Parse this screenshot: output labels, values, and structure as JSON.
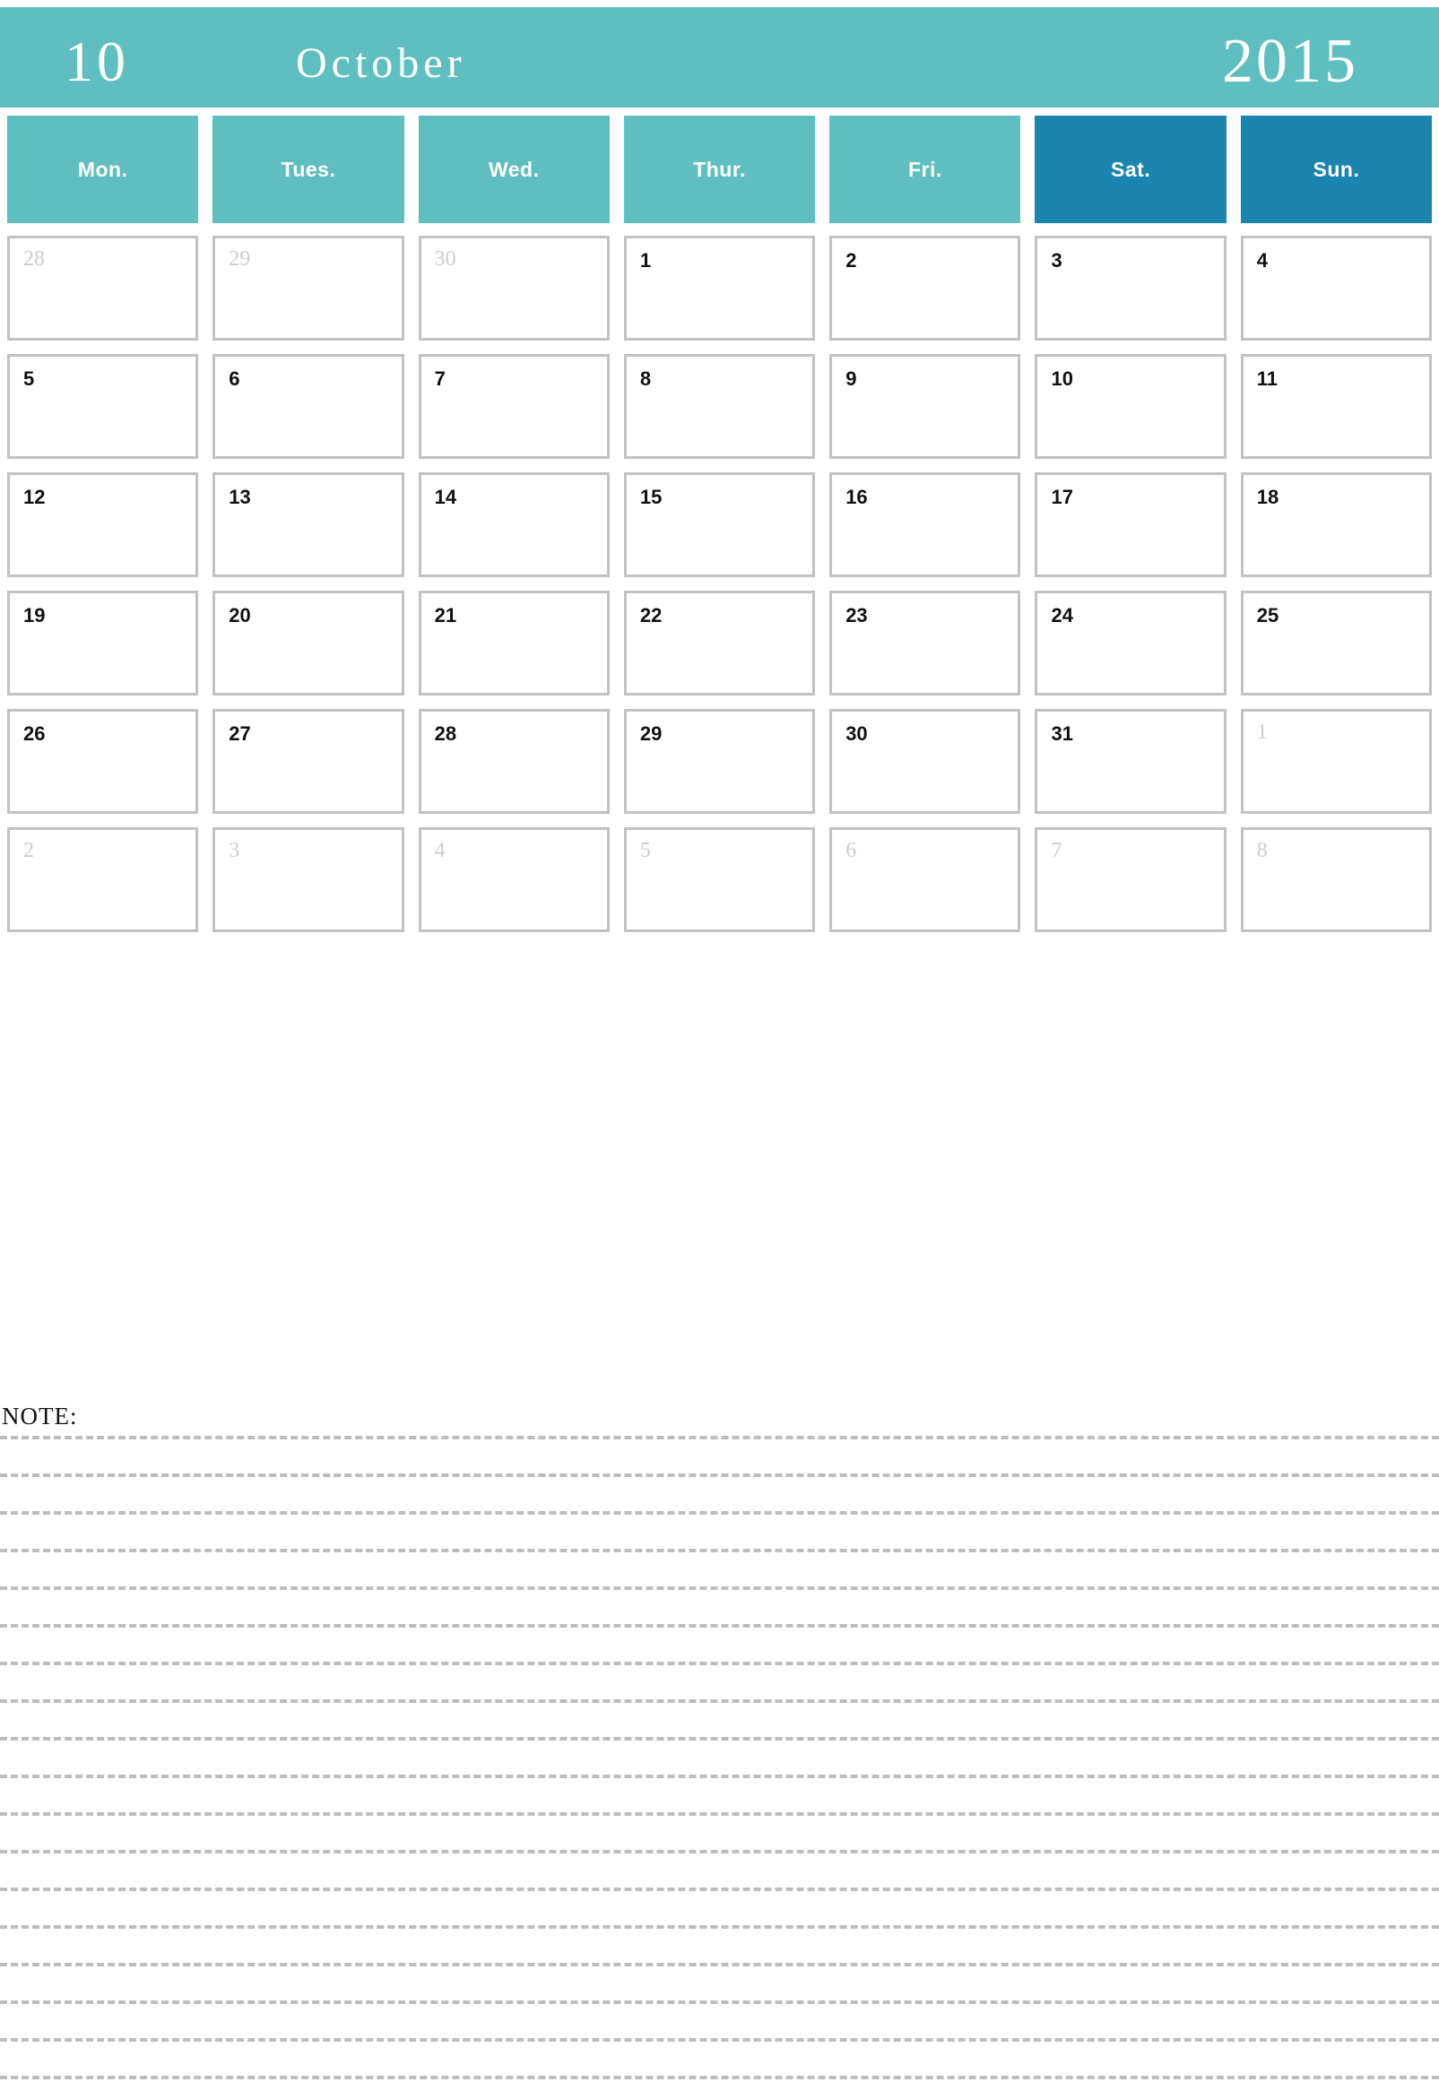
{
  "header": {
    "month_number": "10",
    "month_name": "October",
    "year": "2015",
    "background_color": "#5FBFC0",
    "text_color": "#ffffff"
  },
  "colors": {
    "weekday_header": "#5FBFC0",
    "weekend_header": "#1B85AE",
    "cell_border": "#c2c2c2",
    "active_day_text": "#111111",
    "muted_day_text": "#cccccc",
    "note_line": "#bdbdbd"
  },
  "weekday_headers": [
    {
      "label": "Mon.",
      "weekend": false
    },
    {
      "label": "Tues.",
      "weekend": false
    },
    {
      "label": "Wed.",
      "weekend": false
    },
    {
      "label": "Thur.",
      "weekend": false
    },
    {
      "label": "Fri.",
      "weekend": false
    },
    {
      "label": "Sat.",
      "weekend": true
    },
    {
      "label": "Sun.",
      "weekend": true
    }
  ],
  "weeks": [
    [
      {
        "day": "28",
        "muted": true
      },
      {
        "day": "29",
        "muted": true
      },
      {
        "day": "30",
        "muted": true
      },
      {
        "day": "1",
        "muted": false
      },
      {
        "day": "2",
        "muted": false
      },
      {
        "day": "3",
        "muted": false
      },
      {
        "day": "4",
        "muted": false
      }
    ],
    [
      {
        "day": "5",
        "muted": false
      },
      {
        "day": "6",
        "muted": false
      },
      {
        "day": "7",
        "muted": false
      },
      {
        "day": "8",
        "muted": false
      },
      {
        "day": "9",
        "muted": false
      },
      {
        "day": "10",
        "muted": false
      },
      {
        "day": "11",
        "muted": false
      }
    ],
    [
      {
        "day": "12",
        "muted": false
      },
      {
        "day": "13",
        "muted": false
      },
      {
        "day": "14",
        "muted": false
      },
      {
        "day": "15",
        "muted": false
      },
      {
        "day": "16",
        "muted": false
      },
      {
        "day": "17",
        "muted": false
      },
      {
        "day": "18",
        "muted": false
      }
    ],
    [
      {
        "day": "19",
        "muted": false
      },
      {
        "day": "20",
        "muted": false
      },
      {
        "day": "21",
        "muted": false
      },
      {
        "day": "22",
        "muted": false
      },
      {
        "day": "23",
        "muted": false
      },
      {
        "day": "24",
        "muted": false
      },
      {
        "day": "25",
        "muted": false
      }
    ],
    [
      {
        "day": "26",
        "muted": false
      },
      {
        "day": "27",
        "muted": false
      },
      {
        "day": "28",
        "muted": false
      },
      {
        "day": "29",
        "muted": false
      },
      {
        "day": "30",
        "muted": false
      },
      {
        "day": "31",
        "muted": false
      },
      {
        "day": "1",
        "muted": true
      }
    ],
    [
      {
        "day": "2",
        "muted": true
      },
      {
        "day": "3",
        "muted": true
      },
      {
        "day": "4",
        "muted": true
      },
      {
        "day": "5",
        "muted": true
      },
      {
        "day": "6",
        "muted": true
      },
      {
        "day": "7",
        "muted": true
      },
      {
        "day": "8",
        "muted": true
      }
    ]
  ],
  "note": {
    "label": "NOTE:",
    "line_count": 18
  }
}
